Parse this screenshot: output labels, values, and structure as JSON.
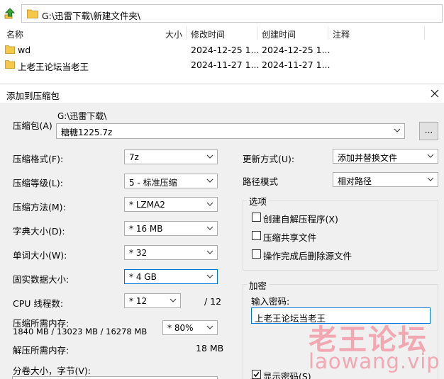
{
  "file_manager": {
    "address": "G:\\迅雷下载\\新建文件夹\\",
    "columns": [
      "名称",
      "大小",
      "修改时间",
      "创建时间",
      "注释"
    ],
    "rows": [
      {
        "name": "wd",
        "modified": "2024-12-25 1...",
        "created": "2024-12-25 1..."
      },
      {
        "name": "上老王论坛当老王",
        "modified": "2024-11-27 1...",
        "created": "2024-11-27 1..."
      }
    ]
  },
  "dialog": {
    "title": "添加到压缩包",
    "archive_label": "压缩包(A)",
    "archive_path": "G:\\迅雷下载\\",
    "archive_name": "糖糖1225.7z",
    "browse_label": "...",
    "format_label": "压缩格式(F):",
    "format_value": "7z",
    "level_label": "压缩等级(L):",
    "level_value": "5 - 标准压缩",
    "method_label": "压缩方法(M):",
    "method_value": "* LZMA2",
    "dict_label": "字典大小(D):",
    "dict_value": "* 16 MB",
    "word_label": "单词大小(W):",
    "word_value": "* 32",
    "solid_label": "固实数据大小:",
    "solid_value": "* 4 GB",
    "cpu_label": "CPU 线程数:",
    "cpu_value": "* 12",
    "cpu_max": "/ 12",
    "mem_comp_label": "压缩所需内存:",
    "mem_comp_detail": "1840 MB / 13023 MB / 16278 MB",
    "mem_comp_value": "* 80%",
    "mem_decomp_label": "解压所需内存:",
    "mem_decomp_value": "18 MB",
    "split_label": "分卷大小，字节(V):",
    "update_label": "更新方式(U):",
    "update_value": "添加并替换文件",
    "path_mode_label": "路径模式",
    "path_mode_value": "相对路径",
    "options_title": "选项",
    "opt_sfx": "创建自解压程序(X)",
    "opt_shared": "压缩共享文件",
    "opt_delete": "操作完成后删除源文件",
    "encryption_title": "加密",
    "password_label": "输入密码:",
    "password_value": "上老王论坛当老王",
    "show_password": "显示密码(S)"
  },
  "watermark": {
    "line1": "老王论坛",
    "line2": "laowang.vip"
  },
  "colors": {
    "folder": "#f6c84a",
    "focus_border": "#0078d7",
    "dialog_bg": "#f0f0f0",
    "watermark": "#f2a8b2"
  }
}
